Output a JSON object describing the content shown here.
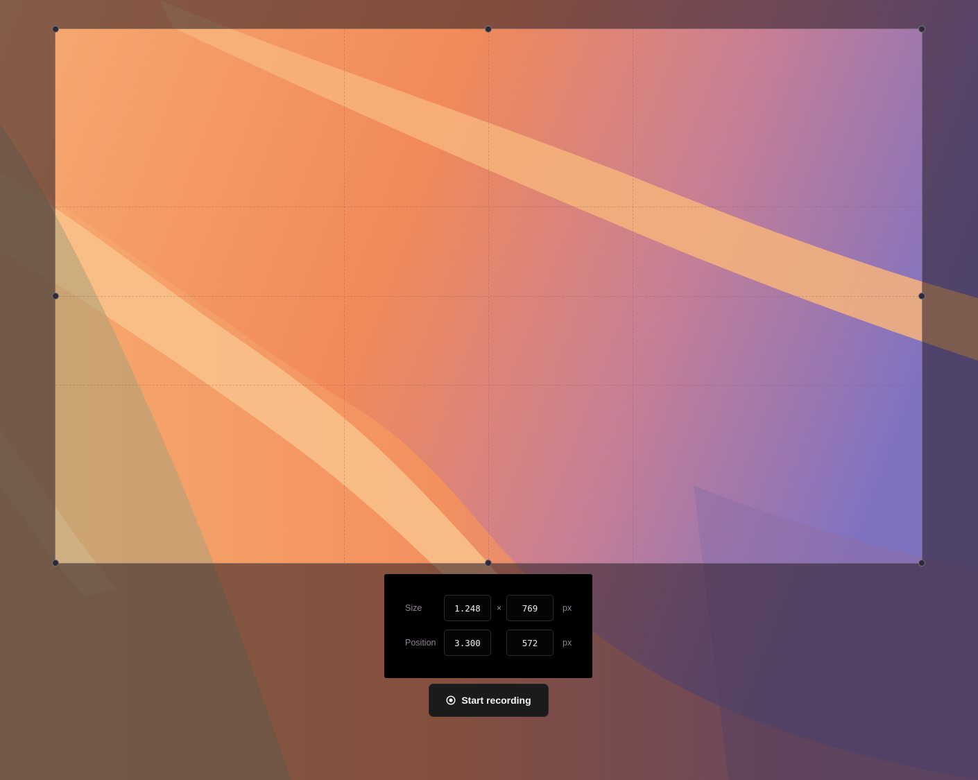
{
  "panel": {
    "size_label": "Size",
    "position_label": "Position",
    "size_width": "1.248",
    "size_height": "769",
    "position_x": "3.300",
    "position_y": "572",
    "times_symbol": "×",
    "unit": "px"
  },
  "record_button": {
    "label": "Start recording",
    "icon": "record-circle-icon"
  },
  "colors": {
    "panel_background": "#000000",
    "button_background": "#1b1b1b",
    "wallpaper_orange": "#f2925c",
    "wallpaper_purple": "#8c74bd"
  }
}
